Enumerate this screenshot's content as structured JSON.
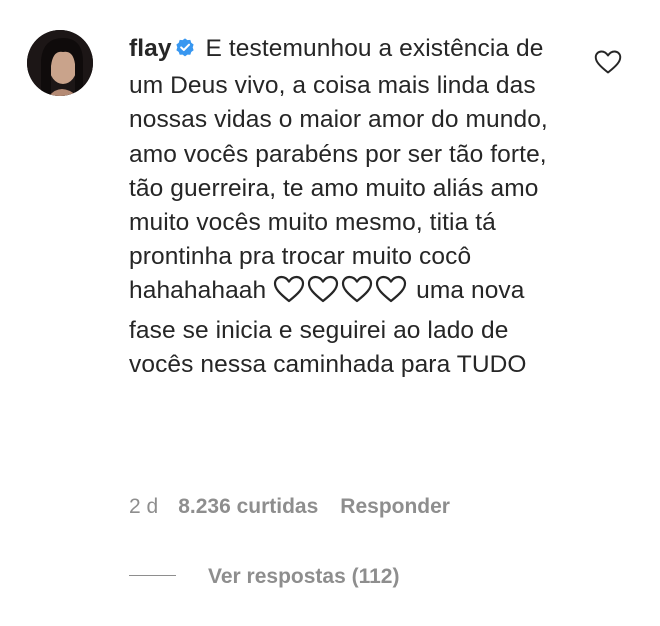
{
  "comment": {
    "username": "flay",
    "verified": true,
    "text_part1": "E testemunhou a existência de um Deus vivo, a coisa mais linda das nossas vidas o maior amor do mundo, amo vocês parabéns por ser tão forte, tão guerreira, te amo muito aliás amo muito vocês muito mesmo, titia tá prontinha pra trocar muito cocô hahahahaah",
    "text_part2": "uma nova fase se inicia e seguirei ao lado de vocês nessa caminhada para TUDO",
    "inline_icons": [
      "heart-outline-icon",
      "heart-outline-icon",
      "heart-outline-icon",
      "heart-outline-icon"
    ],
    "time": "2 d",
    "likes": "8.236 curtidas",
    "reply_label": "Responder",
    "view_replies": "Ver respostas (112)"
  },
  "icons": {
    "like": "heart-outline-icon",
    "verified": "verified-badge-icon"
  },
  "colors": {
    "text": "#262626",
    "secondary": "#8e8e8e",
    "verified": "#3897f0"
  }
}
